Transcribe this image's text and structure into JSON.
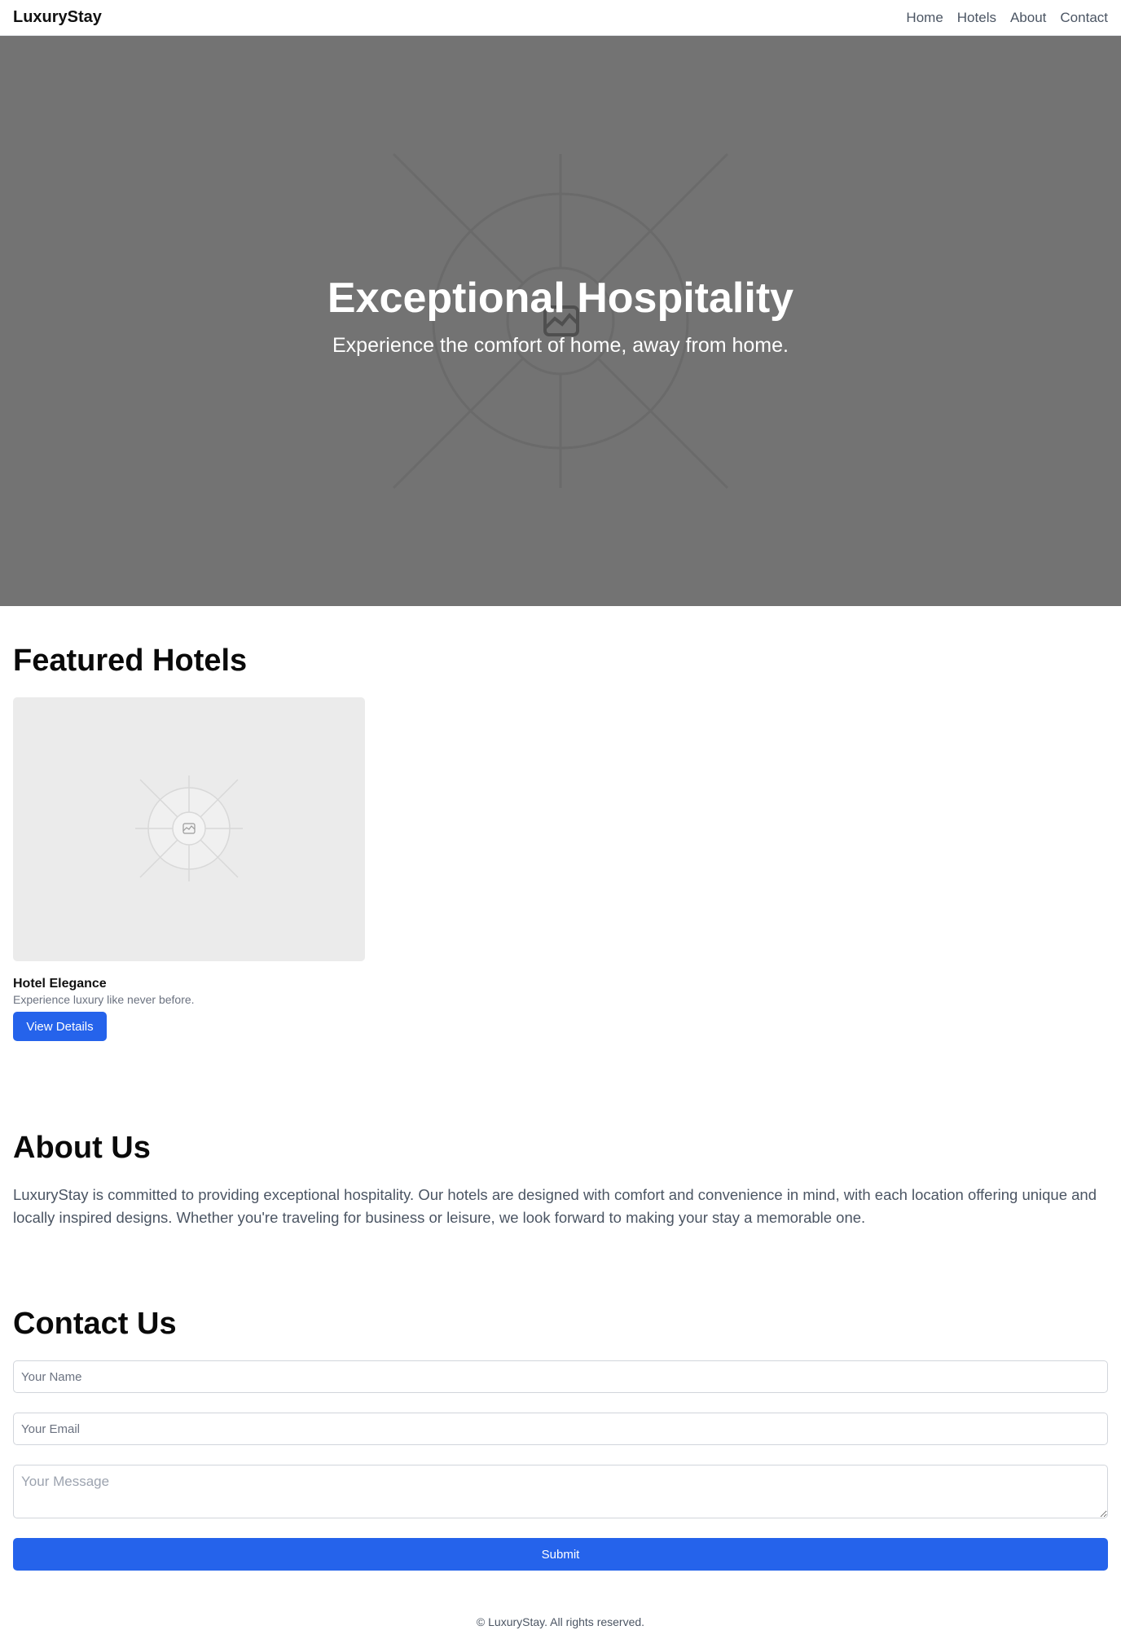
{
  "header": {
    "brand": "LuxuryStay",
    "nav": [
      "Home",
      "Hotels",
      "About",
      "Contact"
    ]
  },
  "hero": {
    "title": "Exceptional Hospitality",
    "subtitle": "Experience the comfort of home, away from home.",
    "image_icon": "image-placeholder-icon"
  },
  "featured": {
    "heading": "Featured Hotels",
    "hotels": [
      {
        "name": "Hotel Elegance",
        "description": "Experience luxury like never before.",
        "button": "View Details"
      }
    ]
  },
  "about": {
    "heading": "About Us",
    "text": "LuxuryStay is committed to providing exceptional hospitality. Our hotels are designed with comfort and convenience in mind, with each location offering unique and locally inspired designs. Whether you're traveling for business or leisure, we look forward to making your stay a memorable one."
  },
  "contact": {
    "heading": "Contact Us",
    "name_placeholder": "Your Name",
    "email_placeholder": "Your Email",
    "message_placeholder": "Your Message",
    "submit": "Submit"
  },
  "footer": {
    "text": "© LuxuryStay. All rights reserved."
  },
  "colors": {
    "accent": "#2563eb",
    "hero_bg": "#737373",
    "placeholder_bg": "#ebebeb"
  }
}
